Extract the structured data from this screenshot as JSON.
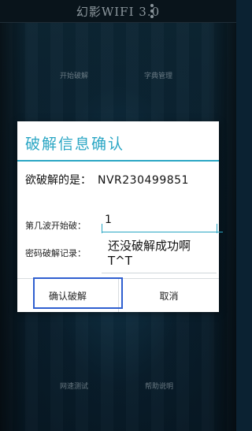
{
  "app": {
    "title": "幻影WIFI 3.0"
  },
  "background_menu": {
    "top_left": "开始破解",
    "top_right": "字典管理",
    "bottom_left": "网速测试",
    "bottom_right": "帮助说明"
  },
  "dialog": {
    "title": "破解信息确认",
    "target_label": "欲破解的是：",
    "target_value": "NVR230499851",
    "wave_label": "第几波开始破：",
    "wave_value": "1",
    "record_label": "密码破解记录：",
    "record_value": "还没破解成功啊 T^T",
    "confirm_label": "确认破解",
    "cancel_label": "取消"
  },
  "colors": {
    "accent": "#2aa6c4",
    "highlight_box": "#2f5fd0"
  }
}
